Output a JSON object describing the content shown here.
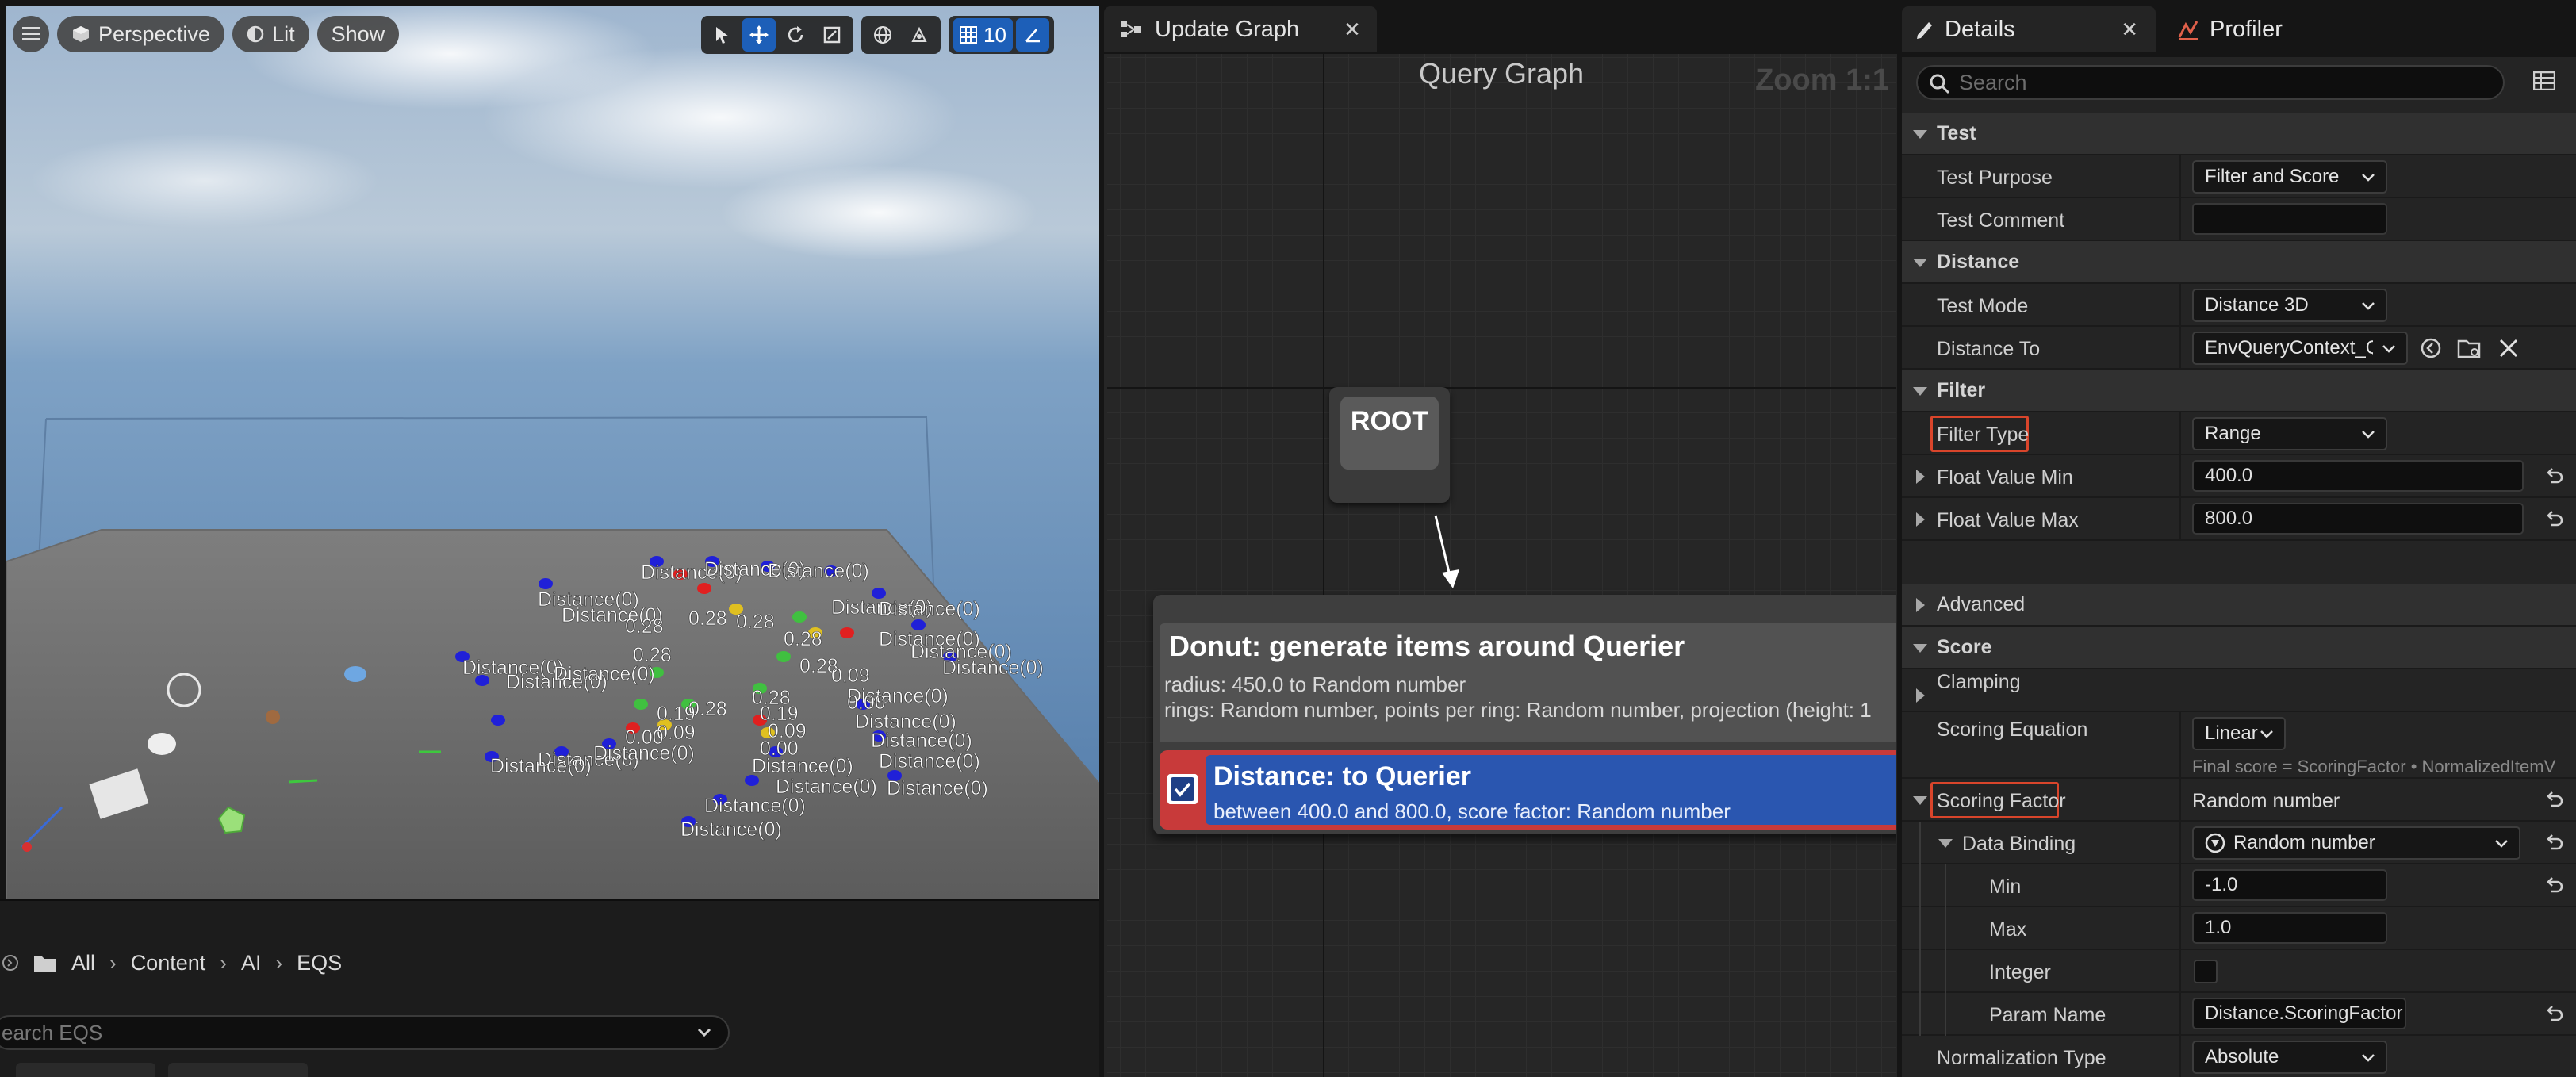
{
  "viewport": {
    "toolbar": {
      "perspective_label": "Perspective",
      "lit_label": "Lit",
      "show_label": "Show",
      "grid_value": "10"
    },
    "labels": {
      "distance_zero": "Distance(0)",
      "v028": "0.28",
      "v019": "0.19",
      "v009": "0.09",
      "v000": "0.00"
    },
    "colors": {
      "blue": "#2020d8",
      "red": "#e02020",
      "green": "#40c040",
      "yellow": "#e0c020"
    }
  },
  "content_browser": {
    "breadcrumb": [
      "All",
      "Content",
      "AI",
      "EQS"
    ],
    "search_placeholder": "earch EQS"
  },
  "graph": {
    "tab_label": "Update Graph",
    "title": "Query Graph",
    "zoom": "Zoom 1:1",
    "root_label": "ROOT",
    "generator": {
      "title": "Donut: generate items around Querier",
      "line1": "radius: 450.0 to Random number",
      "line2": "rings: Random number, points per ring: Random number, projection (height: 1"
    },
    "test": {
      "title": "Distance: to Querier",
      "subtitle": "between 400.0 and 800.0, score factor: Random number",
      "accent": "#c83a3a",
      "body": "#2a56b0"
    }
  },
  "details": {
    "tab_details": "Details",
    "tab_profiler": "Profiler",
    "search_placeholder": "Search",
    "sections": {
      "test": "Test",
      "distance": "Distance",
      "filter": "Filter",
      "advanced": "Advanced",
      "score": "Score"
    },
    "rows": {
      "test_purpose": {
        "label": "Test Purpose",
        "value": "Filter and Score"
      },
      "test_comment": {
        "label": "Test Comment",
        "value": ""
      },
      "test_mode": {
        "label": "Test Mode",
        "value": "Distance 3D"
      },
      "distance_to": {
        "label": "Distance To",
        "value": "EnvQueryContext_Que"
      },
      "filter_type": {
        "label": "Filter Type",
        "value": "Range"
      },
      "float_min": {
        "label": "Float Value Min",
        "value": "400.0"
      },
      "float_max": {
        "label": "Float Value Max",
        "value": "800.0"
      },
      "clamping": {
        "label": "Clamping"
      },
      "scoring_equation": {
        "label": "Scoring Equation",
        "value": "Linear",
        "hint": "Final score = ScoringFactor • NormalizedItemV"
      },
      "scoring_factor": {
        "label": "Scoring Factor",
        "value": "Random number"
      },
      "data_binding": {
        "label": "Data Binding",
        "value": "Random number"
      },
      "min": {
        "label": "Min",
        "value": "-1.0"
      },
      "max": {
        "label": "Max",
        "value": "1.0"
      },
      "integer": {
        "label": "Integer"
      },
      "param_name": {
        "label": "Param Name",
        "value": "Distance.ScoringFactor"
      },
      "normalization_type": {
        "label": "Normalization Type",
        "value": "Absolute"
      }
    },
    "highlight_color": "#d9452b"
  }
}
